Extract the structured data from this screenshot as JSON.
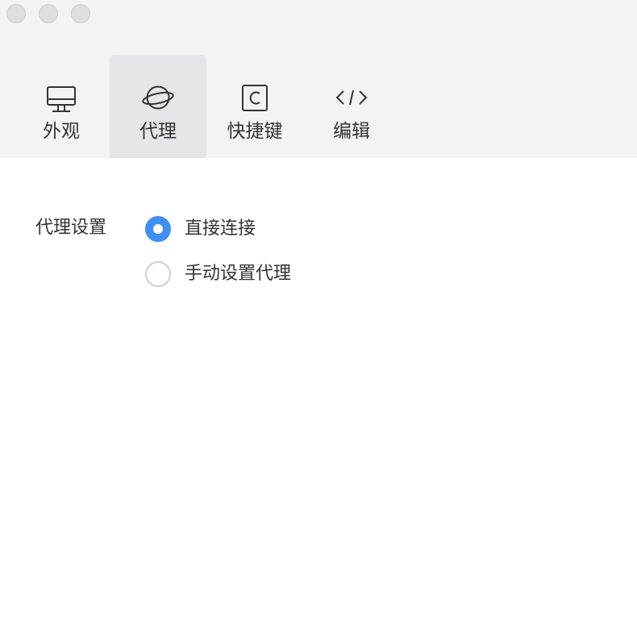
{
  "window": {
    "traffic_lights": [
      "close",
      "minimize",
      "zoom"
    ]
  },
  "tabs": [
    {
      "label": "外观",
      "icon": "monitor-icon",
      "active": false
    },
    {
      "label": "代理",
      "icon": "planet-icon",
      "active": true
    },
    {
      "label": "快捷键",
      "icon": "command-key-icon",
      "active": false
    },
    {
      "label": "编辑",
      "icon": "code-icon",
      "active": false
    }
  ],
  "proxy": {
    "section_label": "代理设置",
    "options": [
      {
        "label": "直接连接",
        "selected": true
      },
      {
        "label": "手动设置代理",
        "selected": false
      }
    ]
  },
  "colors": {
    "accent": "#3d8ff5",
    "toolbar_bg": "#f2f3f5",
    "active_tab_bg": "#e5e6e9"
  }
}
